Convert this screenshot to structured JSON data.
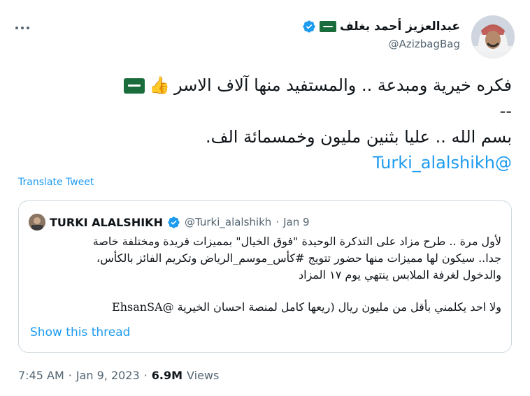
{
  "author": {
    "display_name": "عبدالعزيز أحمد بغلف",
    "handle": "@AzizbagBag",
    "verified": true
  },
  "tweet": {
    "line1": "فكره خيرية ومبدعة .. والمستفيد منها آلاف الاسر",
    "line2": "--",
    "line3": "بسم الله .. عليا بثنين مليون وخمسمائة الف.",
    "mention": "@Turki_alalshikh",
    "emoji_thumb": "👍"
  },
  "translate_label": "Translate Tweet",
  "quote": {
    "name": "TURKI ALALSHIKH",
    "handle": "@Turki_alalshikh",
    "separator": "·",
    "date": "Jan 9",
    "paragraph1_line1": "لأول مرة .. طرح مزاد على التذكرة الوحيدة \"فوق الخيال\" بمميزات فريدة ومختلفة خاصة",
    "paragraph1_line2": "جدا.. سيكون لها مميزات منها حضور تتويج #كأس_موسم_الرياض وتكريم الفائز بالكأس،",
    "paragraph1_line3": "والدخول لغرفة الملابس ينتهي يوم ١٧ المزاد",
    "paragraph2": "ولا احد يكلمني بأقل من مليون ريال (ريعها كامل لمنصة احسان الخيرية @EhsanSA",
    "show_thread": "Show this thread"
  },
  "meta": {
    "time": "7:45 AM",
    "separator1": "·",
    "date": "Jan 9, 2023",
    "separator2": "·",
    "views_count": "6.9M",
    "views_label": "Views"
  },
  "colors": {
    "link": "#1d9bf0",
    "secondary_text": "#536471",
    "border": "#cfd9de",
    "flag_green": "#1b6c3c"
  },
  "icons": [
    "more-icon",
    "verified-badge-icon",
    "saudi-flag-icon",
    "thumbs-up-icon"
  ]
}
